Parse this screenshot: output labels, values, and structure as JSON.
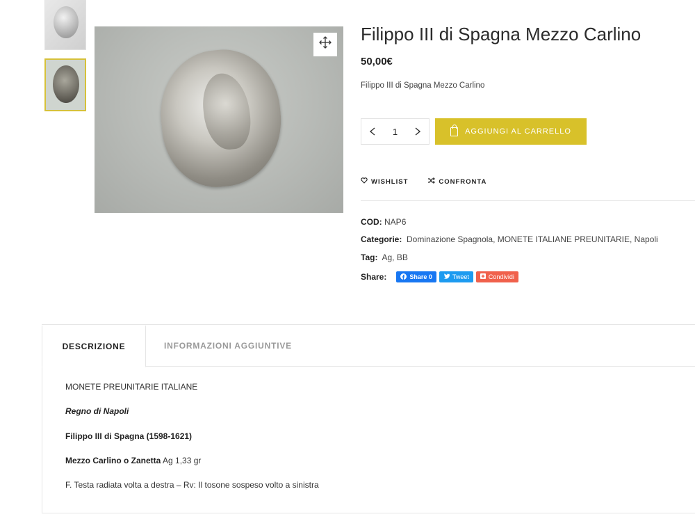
{
  "product": {
    "title": "Filippo III di Spagna Mezzo Carlino",
    "price": "50,00€",
    "short_description": "Filippo III di Spagna Mezzo Carlino",
    "quantity": "1",
    "add_to_cart_label": "AGGIUNGI AL CARRELLO",
    "wishlist_label": "WISHLIST",
    "compare_label": "CONFRONTA"
  },
  "meta": {
    "cod_label": "COD:",
    "cod_value": "NAP6",
    "categories_label": "Categorie:",
    "categories_value": "Dominazione Spagnola, MONETE ITALIANE PREUNITARIE, Napoli",
    "tag_label": "Tag:",
    "tag_value": "Ag, BB",
    "share_label": "Share:",
    "share_fb": "Share 0",
    "share_tw": "Tweet",
    "share_other": "Condividi"
  },
  "tabs": [
    {
      "label": "DESCRIZIONE",
      "active": true
    },
    {
      "label": "INFORMAZIONI AGGIUNTIVE",
      "active": false
    }
  ],
  "description": {
    "line1": "MONETE PREUNITARIE ITALIANE",
    "line2": "Regno di Napoli",
    "line3": "Filippo III di Spagna (1598-1621)",
    "line4_bold": "Mezzo Carlino o Zanetta",
    "line4_rest": " Ag  1,33  gr",
    "line5": "F. Testa radiata volta a destra – Rv: Il tosone sospeso volto a sinistra"
  },
  "icons": {
    "zoom": "move-arrows-icon",
    "minus": "chevron-left-icon",
    "plus": "chevron-right-icon",
    "cart": "bag-icon",
    "wishlist": "heart-icon",
    "compare": "shuffle-icon"
  },
  "colors": {
    "accent": "#d8c12a",
    "facebook": "#1877f2",
    "twitter": "#1d9bf0",
    "share": "#f0614c"
  }
}
